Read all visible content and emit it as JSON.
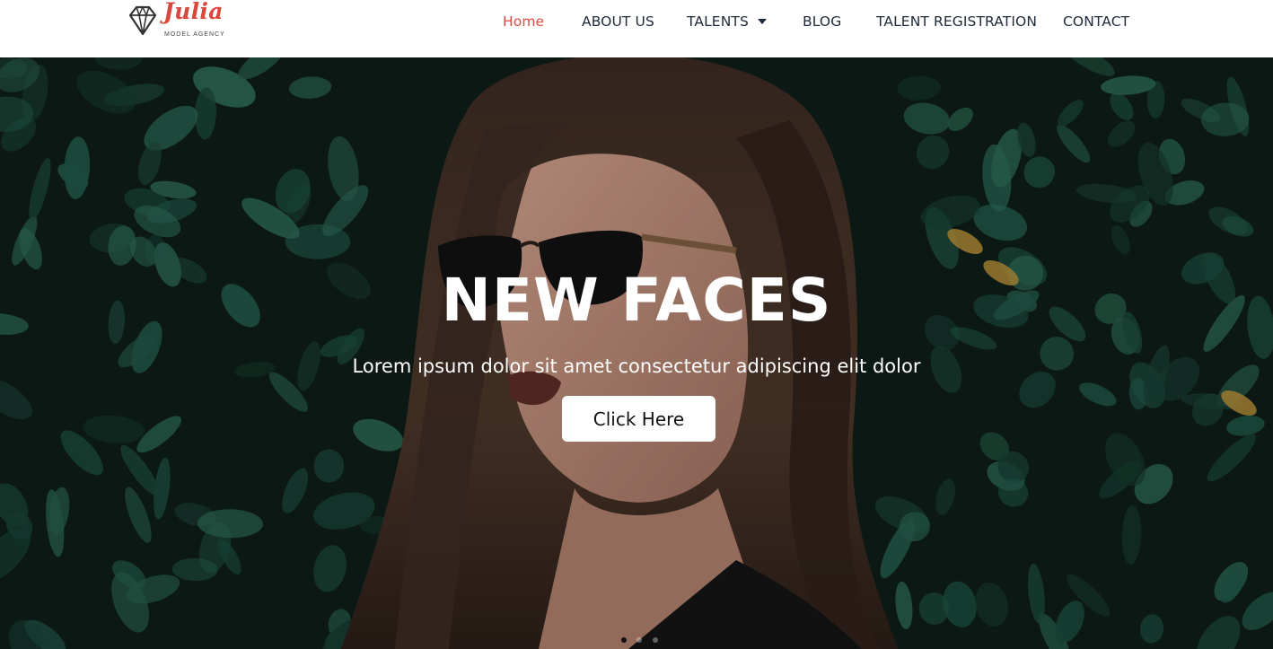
{
  "brand": {
    "name": "Julia",
    "tagline": "MODEL AGENCY",
    "icon": "diamond-icon",
    "color": "#d9473e"
  },
  "nav": {
    "items": [
      {
        "label": "Home",
        "active": true
      },
      {
        "label": "ABOUT US"
      },
      {
        "label": "TALENTS",
        "icon": "caret-down-icon"
      },
      {
        "label": "BLOG"
      },
      {
        "label": "TALENT REGISTRATION"
      },
      {
        "label": "CONTACT"
      }
    ],
    "active_color": "#e0493f"
  },
  "hero": {
    "title": "NEW FACES",
    "subtitle": "Lorem ipsum dolor sit amet consectetur adipiscing elit dolor",
    "button_label": "Click Here",
    "slides": {
      "count": 3,
      "active": 1
    }
  }
}
